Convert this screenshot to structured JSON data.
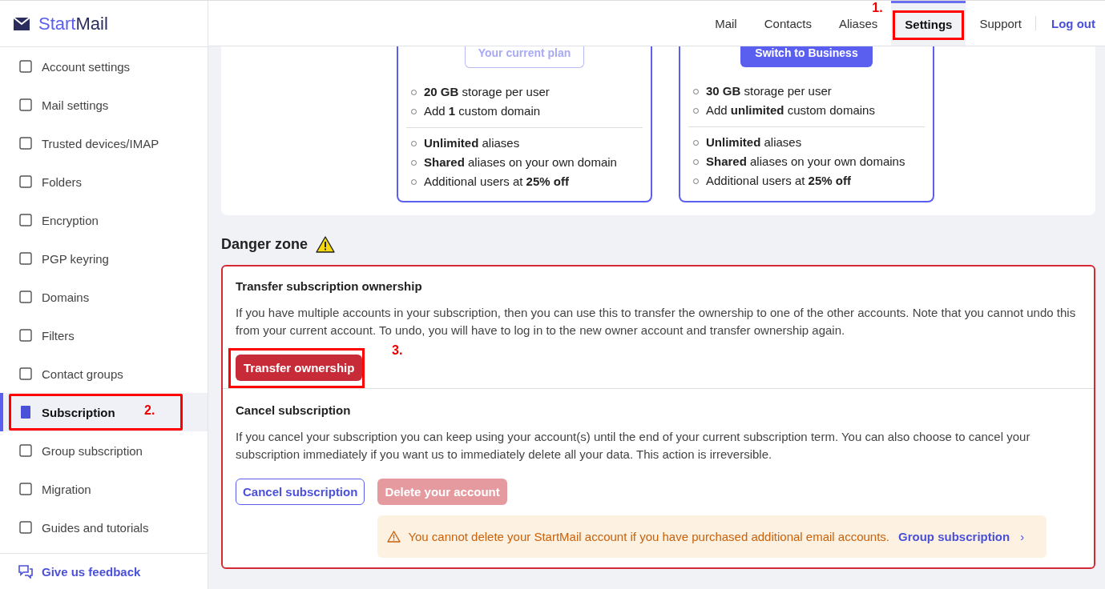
{
  "logo": {
    "part1": "Start",
    "part2": "Mail"
  },
  "sidebar": {
    "items": [
      {
        "label": "Account settings",
        "selected": false
      },
      {
        "label": "Mail settings",
        "selected": false
      },
      {
        "label": "Trusted devices/IMAP",
        "selected": false
      },
      {
        "label": "Folders",
        "selected": false
      },
      {
        "label": "Encryption",
        "selected": false
      },
      {
        "label": "PGP keyring",
        "selected": false
      },
      {
        "label": "Domains",
        "selected": false
      },
      {
        "label": "Filters",
        "selected": false
      },
      {
        "label": "Contact groups",
        "selected": false
      },
      {
        "label": "Subscription",
        "selected": true,
        "annotation": "2."
      },
      {
        "label": "Group subscription",
        "selected": false
      },
      {
        "label": "Migration",
        "selected": false
      },
      {
        "label": "Guides and tutorials",
        "selected": false
      }
    ],
    "feedback": "Give us feedback"
  },
  "nav": {
    "items": [
      {
        "label": "Mail",
        "selected": false
      },
      {
        "label": "Contacts",
        "selected": false
      },
      {
        "label": "Aliases",
        "selected": false
      },
      {
        "label": "Settings",
        "selected": true,
        "annotation": "1."
      },
      {
        "label": "Support",
        "selected": false
      }
    ],
    "logout": "Log out"
  },
  "plans": [
    {
      "button": "Your current plan",
      "current": true,
      "groups": [
        [
          "**20 GB** storage per user",
          "Add **1** custom domain"
        ],
        [
          "**Unlimited** aliases",
          "**Shared** aliases on your own domain",
          "Additional users at **25% off**"
        ]
      ]
    },
    {
      "button": "Switch to Business",
      "current": false,
      "groups": [
        [
          "**30 GB** storage per user",
          "Add **unlimited** custom domains"
        ],
        [
          "**Unlimited** aliases",
          "**Shared** aliases on your own domains",
          "Additional users at **25% off**"
        ]
      ]
    }
  ],
  "danger_zone": {
    "title": "Danger zone",
    "transfer": {
      "title": "Transfer subscription ownership",
      "text": "If you have multiple accounts in your subscription, then you can use this to transfer the ownership to one of the other accounts. Note that you cannot undo this from your current account. To undo, you will have to log in to the new owner account and transfer ownership again.",
      "button": "Transfer ownership",
      "annotation": "3."
    },
    "cancel": {
      "title": "Cancel subscription",
      "text": "If you cancel your subscription you can keep using your account(s) until the end of your current subscription term. You can also choose to cancel your subscription immediately if you want us to immediately delete all your data. This action is irreversible.",
      "cancel_button": "Cancel subscription",
      "delete_button": {
        "label": "Delete your account",
        "disabled": true
      },
      "warning": {
        "text": "You cannot delete your StartMail account if you have purchased additional email accounts.",
        "link": "Group subscription",
        "chevron": "›"
      }
    }
  }
}
